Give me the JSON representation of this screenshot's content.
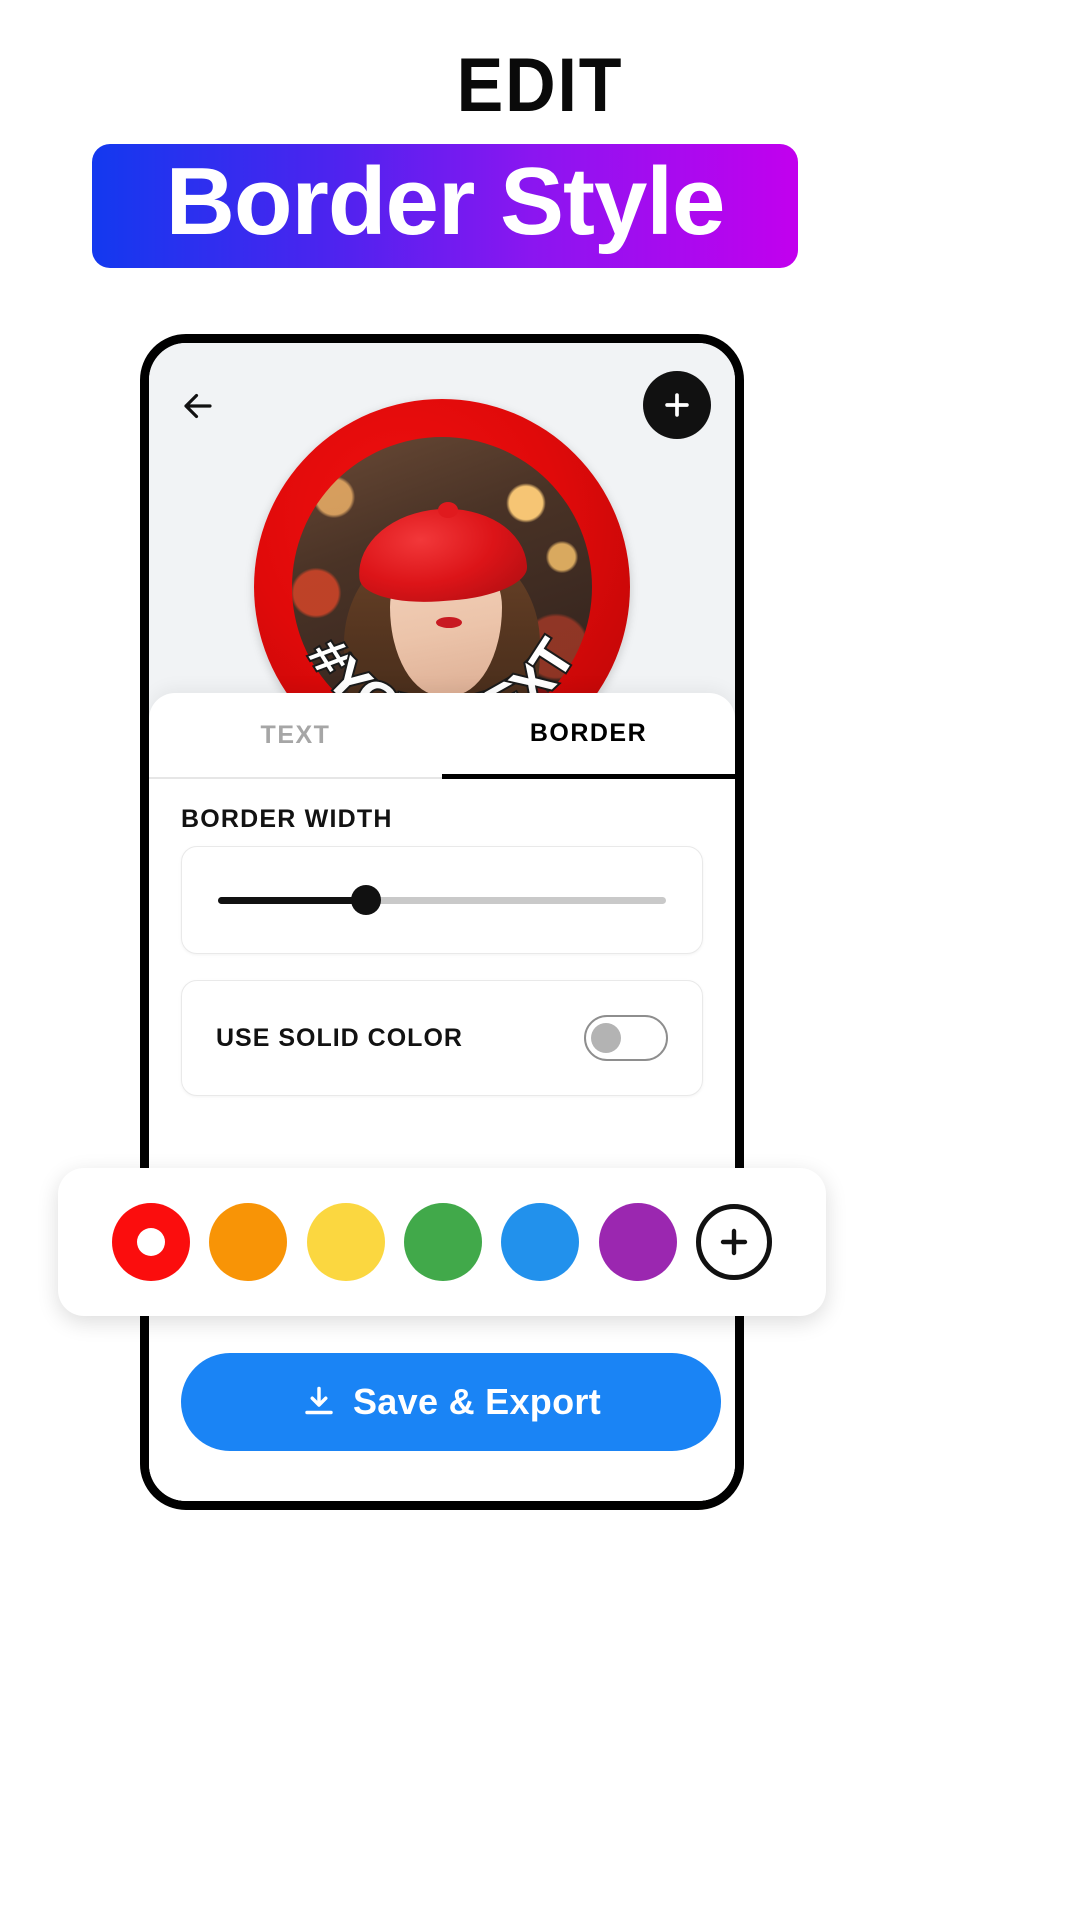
{
  "promo": {
    "eyebrow": "EDIT",
    "headline": "Border Style",
    "gradient_start": "#1339ef",
    "gradient_end": "#c200ee"
  },
  "app": {
    "nav": {
      "back_icon": "arrow-left-icon",
      "add_icon": "plus-icon"
    },
    "preview": {
      "badge_text": "#YOURTEXT",
      "border_color": "#e00a0a"
    },
    "tabs": [
      {
        "label": "TEXT",
        "active": false
      },
      {
        "label": "BORDER",
        "active": true
      }
    ],
    "border_width": {
      "label": "BORDER WIDTH",
      "value_percent": 33
    },
    "solid_color": {
      "label": "USE SOLID COLOR",
      "enabled": false
    },
    "palette": {
      "swatches": [
        {
          "name": "red",
          "color": "#fb0d0d",
          "selected": true
        },
        {
          "name": "orange",
          "color": "#f89406",
          "selected": false
        },
        {
          "name": "yellow",
          "color": "#fbd740",
          "selected": false
        },
        {
          "name": "green",
          "color": "#41a94a",
          "selected": false
        },
        {
          "name": "blue",
          "color": "#2291ec",
          "selected": false
        },
        {
          "name": "purple",
          "color": "#9b27b0",
          "selected": false
        }
      ],
      "add_label": "plus-circle-icon"
    },
    "save_button": {
      "label": "Save & Export",
      "icon": "download-icon",
      "color": "#1a84f5"
    }
  }
}
